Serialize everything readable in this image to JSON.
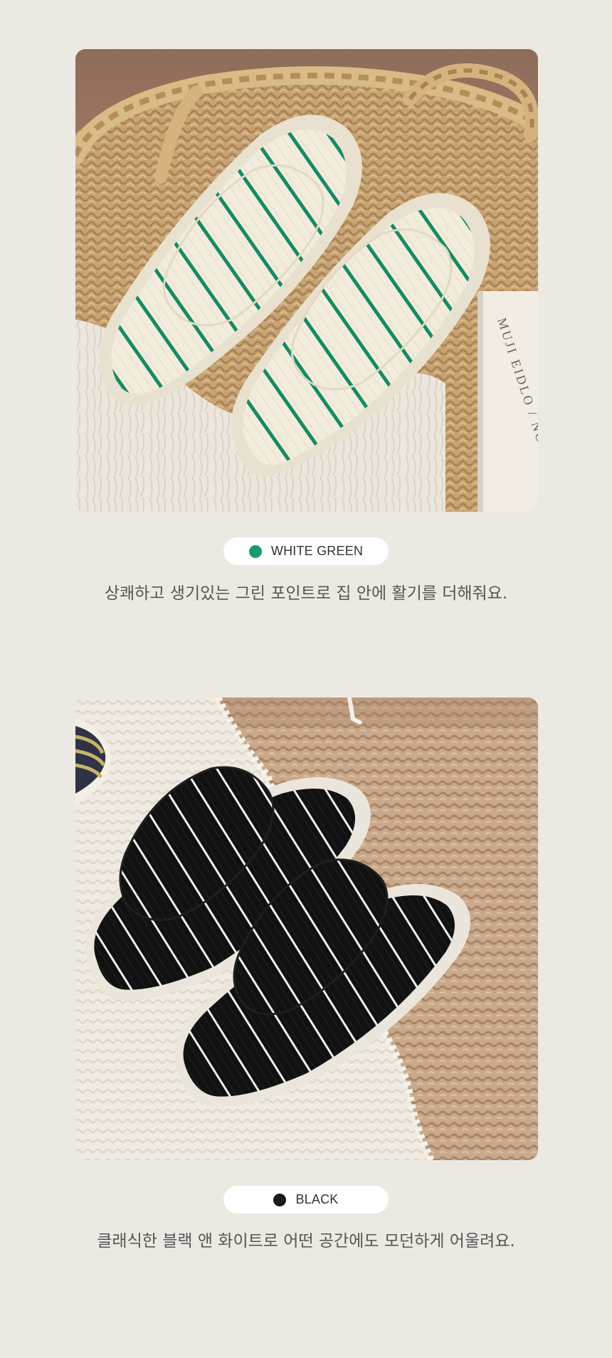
{
  "products": [
    {
      "image_alt": "white slippers with green stripes in a woven basket",
      "swatch_color": "#1a9a6f",
      "color_name": "WHITE GREEN",
      "description": "상쾌하고 생기있는 그린 포인트로 집 안에 활기를 더해줘요."
    },
    {
      "image_alt": "black slippers with white stripes on a woven rug",
      "swatch_color": "#1a1a1a",
      "color_name": "BLACK",
      "description": "클래식한 블랙 앤 화이트로 어떤 공간에도 모던하게 어울려요."
    }
  ],
  "book_spine_text": "MUJI EIDLO / NO"
}
